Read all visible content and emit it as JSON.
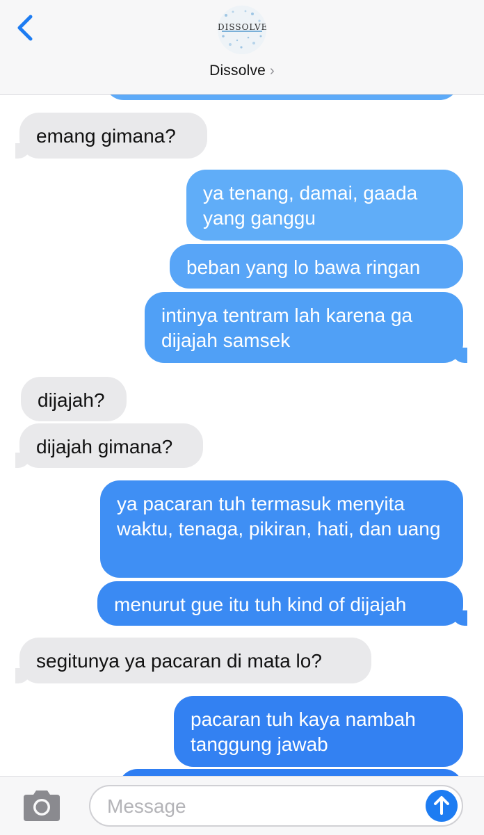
{
  "header": {
    "avatar_text": "DISSOLVE",
    "contact_name": "Dissolve",
    "chevron": "›",
    "back_icon": "chevron-left-icon"
  },
  "messages": [
    {
      "from": "contact",
      "text": "emang gimana?"
    },
    {
      "from": "me",
      "text": "ya tenang, damai, gaada yang ganggu"
    },
    {
      "from": "me",
      "text": "beban yang lo bawa ringan"
    },
    {
      "from": "me",
      "text": "intinya tentram lah karena ga dijajah samsek"
    },
    {
      "from": "contact",
      "text": "dijajah?"
    },
    {
      "from": "contact",
      "text": "dijajah gimana?"
    },
    {
      "from": "me",
      "text": "ya pacaran tuh termasuk menyita waktu, tenaga, pikiran, hati, dan uang"
    },
    {
      "from": "me",
      "text": "menurut gue itu tuh kind of dijajah"
    },
    {
      "from": "contact",
      "text": "segitunya ya pacaran di mata lo?"
    },
    {
      "from": "me",
      "text": "pacaran tuh kaya nambah tanggung jawab"
    }
  ],
  "input": {
    "placeholder": "Message",
    "camera_icon": "camera-icon",
    "send_icon": "arrow-up-icon"
  },
  "colors": {
    "incoming": "#e9e9eb",
    "outgoing_top": "#62aef8",
    "outgoing_bottom": "#2f7ef2",
    "accent": "#1d7cf2"
  }
}
